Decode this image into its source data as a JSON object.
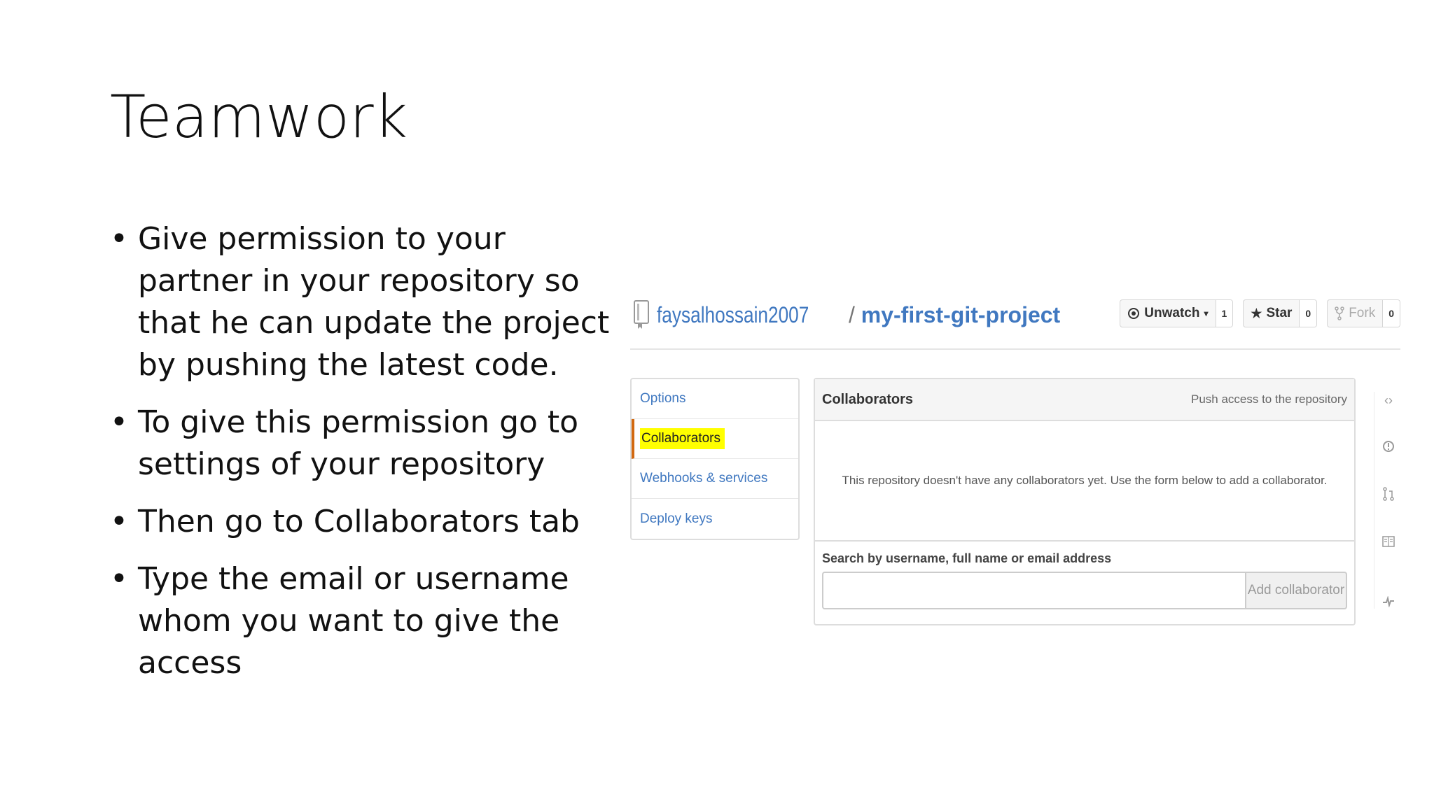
{
  "slide": {
    "title": "Teamwork",
    "bullets": [
      "Give permission to your partner in your repository so that he can update the project by pushing the latest code.",
      "To give this permission go to settings of your repository",
      "Then go to Collaborators tab",
      "Type the email or username whom you want to give the access"
    ]
  },
  "repo": {
    "owner": "faysalhossain2007",
    "separator": " / ",
    "name": "my-first-git-project",
    "icon": "repo-icon"
  },
  "buttons": {
    "watch": {
      "label": "Unwatch",
      "count": "1",
      "icon": "eye-icon"
    },
    "star": {
      "label": "Star",
      "count": "0",
      "icon": "star-icon"
    },
    "fork": {
      "label": "Fork",
      "count": "0",
      "icon": "fork-icon"
    }
  },
  "settings_menu": [
    {
      "label": "Options"
    },
    {
      "label": "Collaborators",
      "selected": true
    },
    {
      "label": "Webhooks & services"
    },
    {
      "label": "Deploy keys"
    }
  ],
  "collaborators": {
    "title": "Collaborators",
    "subtitle": "Push access to the repository",
    "empty_message": "This repository doesn't have any collaborators yet. Use the form below to add a collaborator.",
    "search_label": "Search by username, full name or email address",
    "search_value": "",
    "add_button": "Add collaborator"
  },
  "colors": {
    "link": "#4078c0",
    "highlight": "#ffff00",
    "selected_border": "#d26911"
  }
}
